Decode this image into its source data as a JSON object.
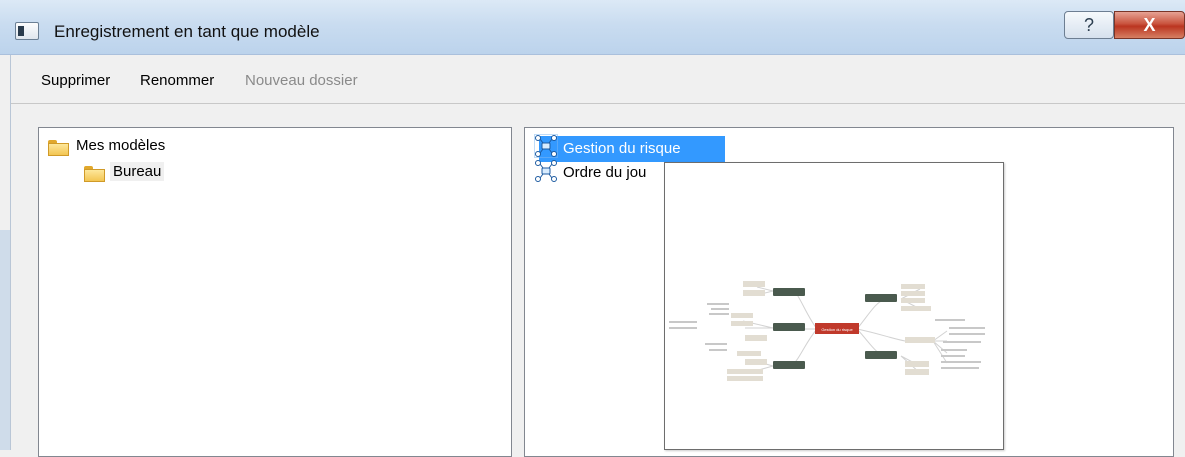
{
  "window": {
    "title": "Enregistrement en tant que modèle",
    "help_button": "?",
    "close_button": "X"
  },
  "toolbar": {
    "delete_label": "Supprimer",
    "rename_label": "Renommer",
    "new_folder_label": "Nouveau dossier"
  },
  "folder_tree": {
    "items": [
      {
        "label": "Mes modèles",
        "icon": "folder-icon",
        "level": 0
      },
      {
        "label": "Bureau",
        "icon": "folder-icon",
        "level": 1
      }
    ]
  },
  "files": {
    "items": [
      {
        "label": "Gestion du risque",
        "icon": "mindmap-icon",
        "selected": true
      },
      {
        "label": "Ordre du jou",
        "icon": "mindmap-icon",
        "selected": false
      }
    ]
  },
  "preview": {
    "central_topic": "Gestion du risque"
  },
  "colors": {
    "selection": "#3399ff",
    "central_topic": "#c0392b",
    "branch_topic": "#4a5a4e",
    "sub_topic": "#e2ddd2"
  }
}
